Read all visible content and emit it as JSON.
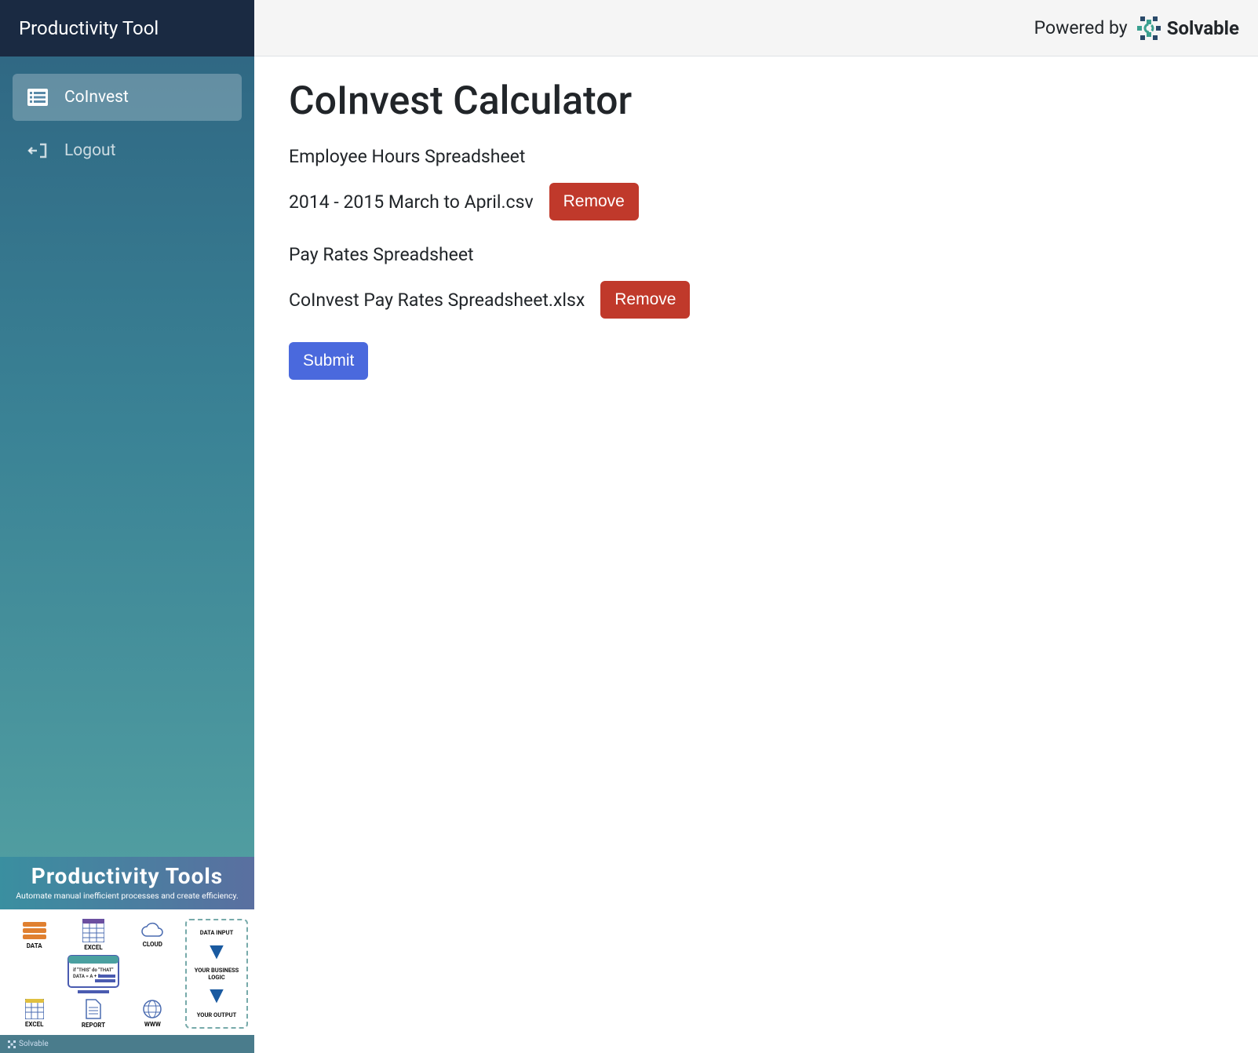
{
  "app_name": "Productivity Tool",
  "sidebar": {
    "items": [
      {
        "label": "CoInvest",
        "active": true
      },
      {
        "label": "Logout",
        "active": false
      }
    ]
  },
  "topbar": {
    "powered_by_text": "Powered by",
    "brand_name": "Solvable"
  },
  "main": {
    "title": "CoInvest Calculator",
    "sections": [
      {
        "label": "Employee Hours Spreadsheet",
        "file_name": "2014 - 2015 March to April.csv",
        "remove_label": "Remove"
      },
      {
        "label": "Pay Rates Spreadsheet",
        "file_name": "CoInvest Pay Rates Spreadsheet.xlsx",
        "remove_label": "Remove"
      }
    ],
    "submit_label": "Submit"
  },
  "promo": {
    "title": "Productivity Tools",
    "subtitle": "Automate manual inefficient processes and create efficiency.",
    "labels": {
      "data": "DATA",
      "excel": "EXCEL",
      "cloud": "CLOUD",
      "report": "REPORT",
      "www": "WWW",
      "data_input": "DATA INPUT",
      "business_logic": "YOUR BUSINESS LOGIC",
      "output": "YOUR OUTPUT",
      "rule1": "if \"THIS\" do \"THAT\"",
      "rule2": "DATA = A + B"
    },
    "footer_brand": "Solvable"
  }
}
